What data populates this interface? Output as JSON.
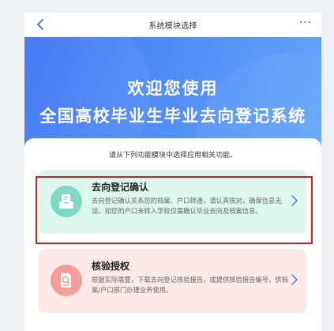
{
  "header": {
    "title": "系统模块选择",
    "back_icon": "chevron-left-icon",
    "more_label": "···"
  },
  "hero": {
    "line1": "欢迎您使用",
    "line2": "全国高校毕业生毕业去向登记系统"
  },
  "main": {
    "instruction": "请从下列功能模块中选择应用相关功能。",
    "cards": [
      {
        "title": "去向登记确认",
        "description": "去向登记确认关系您的档案、户口转递，请认真核对，确保信息无误。如您的户口未转入学校仅需确认毕业去向及档案信息。",
        "icon": "document-inbox-icon",
        "accent": "#7fd9c5",
        "background": "#dcf7ee",
        "highlighted": true
      },
      {
        "title": "核验授权",
        "description": "根据实际需要，下载去向登记核验报告，或提供核验报告编号，供档案/户口部门办理业务使用。",
        "icon": "document-search-icon",
        "accent": "#f59e99",
        "background": "#fde9e8",
        "highlighted": false
      }
    ]
  },
  "colors": {
    "hero_start": "#3e73f4",
    "hero_end": "#67a9f9",
    "highlight_border": "#e01a1a",
    "chevron": "#4f7df0"
  }
}
